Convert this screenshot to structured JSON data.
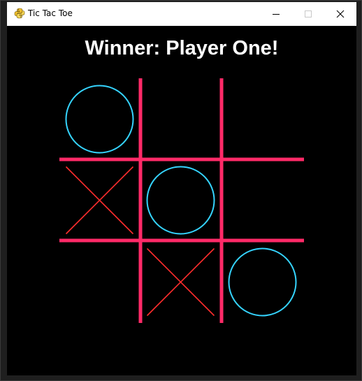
{
  "window": {
    "title": "Tic Tac Toe",
    "icon": "python-icon"
  },
  "game": {
    "status": "Winner: Player One!",
    "board": [
      [
        "O",
        "",
        ""
      ],
      [
        "X",
        "O",
        ""
      ],
      [
        "",
        "X",
        "O"
      ]
    ]
  },
  "colors": {
    "background": "#000000",
    "grid": "#ff2a68",
    "o_mark": "#35d4ff",
    "x_mark": "#ff2d2d",
    "status_text": "#ffffff"
  }
}
